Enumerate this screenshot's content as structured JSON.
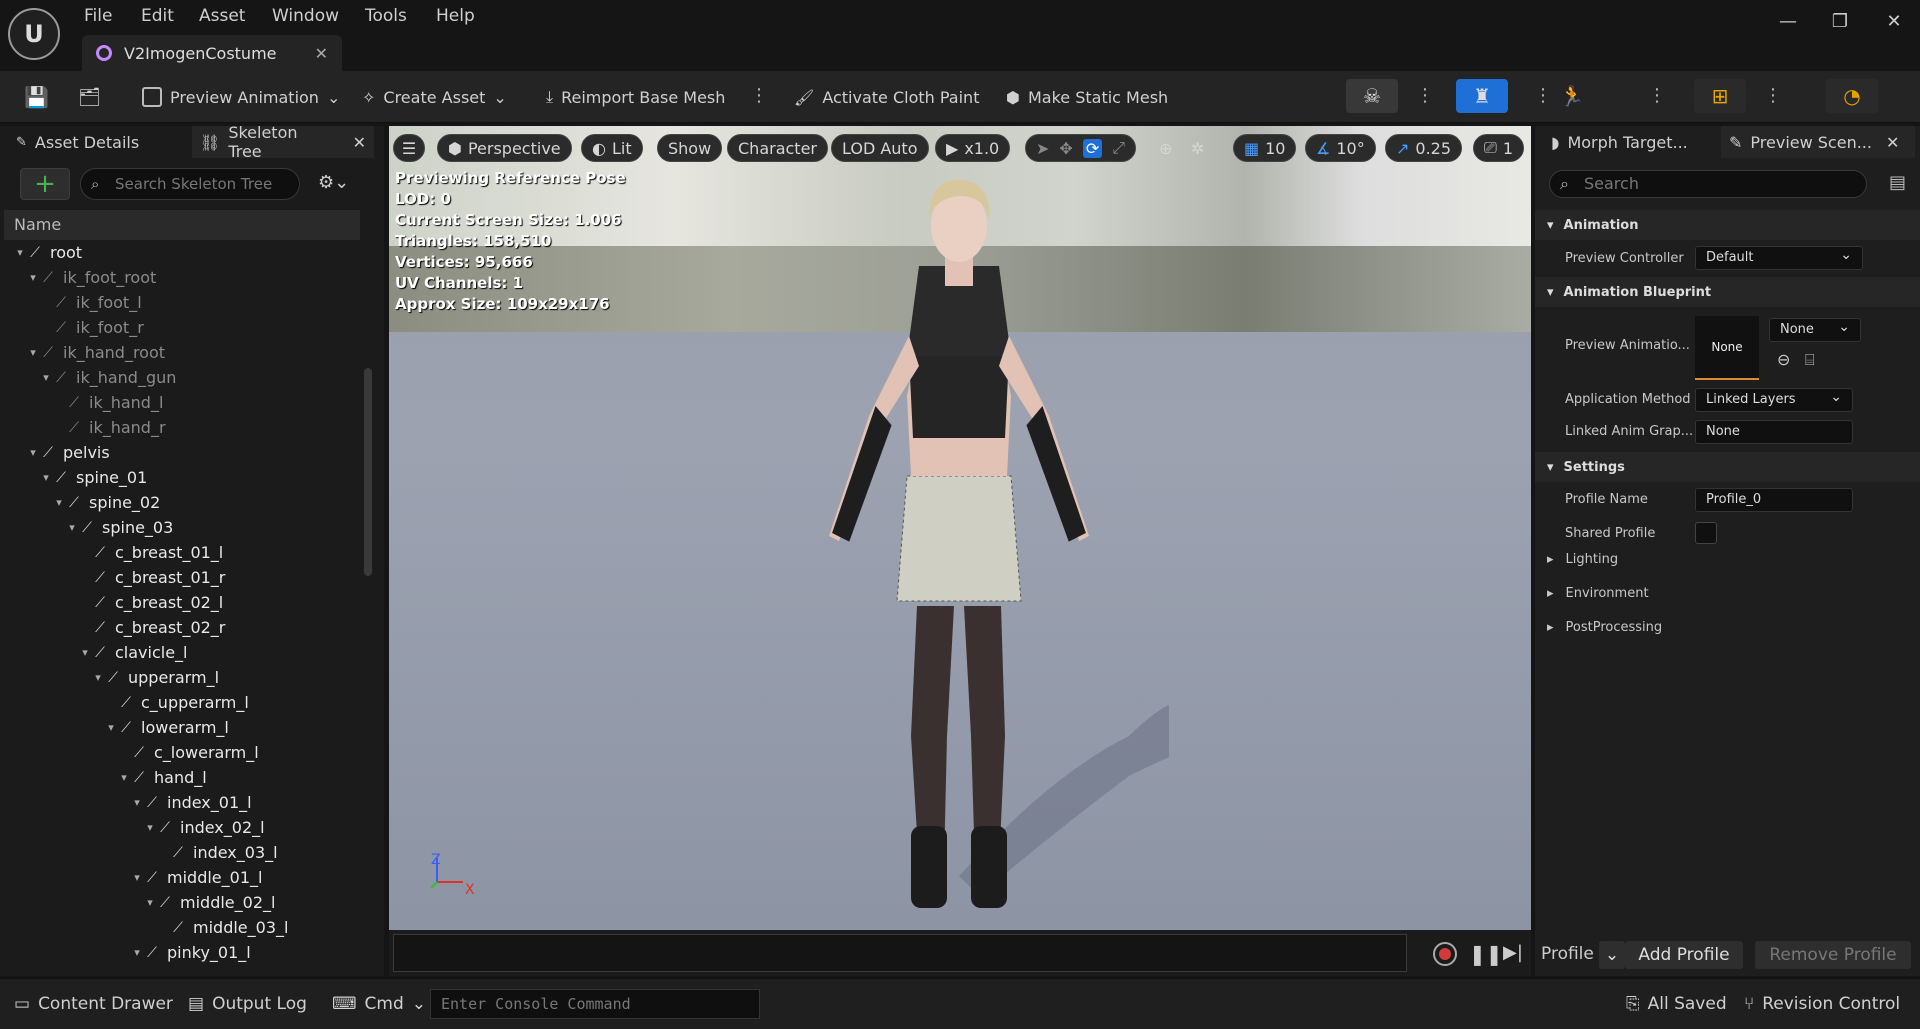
{
  "menu": [
    "File",
    "Edit",
    "Asset",
    "Window",
    "Tools",
    "Help"
  ],
  "doc_tab": "V2ImogenCostume",
  "toolbar": {
    "preview_animation": "Preview Animation",
    "create_asset": "Create Asset",
    "reimport": "Reimport Base Mesh",
    "cloth_paint": "Activate Cloth Paint",
    "static_mesh": "Make Static Mesh"
  },
  "left": {
    "tab1": "Asset Details",
    "tab2": "Skeleton Tree",
    "search_placeholder": "Search Skeleton Tree",
    "name_header": "Name",
    "bones": [
      {
        "name": "root",
        "depth": 0,
        "dim": false,
        "exp": true
      },
      {
        "name": "ik_foot_root",
        "depth": 1,
        "dim": true,
        "exp": true
      },
      {
        "name": "ik_foot_l",
        "depth": 2,
        "dim": true,
        "exp": false
      },
      {
        "name": "ik_foot_r",
        "depth": 2,
        "dim": true,
        "exp": false
      },
      {
        "name": "ik_hand_root",
        "depth": 1,
        "dim": true,
        "exp": true
      },
      {
        "name": "ik_hand_gun",
        "depth": 2,
        "dim": true,
        "exp": true
      },
      {
        "name": "ik_hand_l",
        "depth": 3,
        "dim": true,
        "exp": false
      },
      {
        "name": "ik_hand_r",
        "depth": 3,
        "dim": true,
        "exp": false
      },
      {
        "name": "pelvis",
        "depth": 1,
        "dim": false,
        "exp": true
      },
      {
        "name": "spine_01",
        "depth": 2,
        "dim": false,
        "exp": true
      },
      {
        "name": "spine_02",
        "depth": 3,
        "dim": false,
        "exp": true
      },
      {
        "name": "spine_03",
        "depth": 4,
        "dim": false,
        "exp": true
      },
      {
        "name": "c_breast_01_l",
        "depth": 5,
        "dim": false,
        "exp": false
      },
      {
        "name": "c_breast_01_r",
        "depth": 5,
        "dim": false,
        "exp": false
      },
      {
        "name": "c_breast_02_l",
        "depth": 5,
        "dim": false,
        "exp": false
      },
      {
        "name": "c_breast_02_r",
        "depth": 5,
        "dim": false,
        "exp": false
      },
      {
        "name": "clavicle_l",
        "depth": 5,
        "dim": false,
        "exp": true
      },
      {
        "name": "upperarm_l",
        "depth": 6,
        "dim": false,
        "exp": true
      },
      {
        "name": "c_upperarm_l",
        "depth": 7,
        "dim": false,
        "exp": false
      },
      {
        "name": "lowerarm_l",
        "depth": 7,
        "dim": false,
        "exp": true
      },
      {
        "name": "c_lowerarm_l",
        "depth": 8,
        "dim": false,
        "exp": false
      },
      {
        "name": "hand_l",
        "depth": 8,
        "dim": false,
        "exp": true
      },
      {
        "name": "index_01_l",
        "depth": 9,
        "dim": false,
        "exp": true
      },
      {
        "name": "index_02_l",
        "depth": 10,
        "dim": false,
        "exp": true
      },
      {
        "name": "index_03_l",
        "depth": 11,
        "dim": false,
        "exp": false
      },
      {
        "name": "middle_01_l",
        "depth": 9,
        "dim": false,
        "exp": true
      },
      {
        "name": "middle_02_l",
        "depth": 10,
        "dim": false,
        "exp": true
      },
      {
        "name": "middle_03_l",
        "depth": 11,
        "dim": false,
        "exp": false
      },
      {
        "name": "pinky_01_l",
        "depth": 9,
        "dim": false,
        "exp": true
      }
    ]
  },
  "viewport": {
    "perspective": "Perspective",
    "lit": "Lit",
    "show": "Show",
    "character": "Character",
    "lod": "LOD Auto",
    "play_speed": "x1.0",
    "grid_val": "10",
    "angle_val": "10°",
    "scale_val": "0.25",
    "cam_val": "1",
    "stats": [
      "Previewing Reference Pose",
      "LOD: 0",
      "Current Screen Size: 1.006",
      "Triangles: 158,510",
      "Vertices: 95,666",
      "UV Channels: 1",
      "Approx Size: 109x29x176"
    ],
    "axis_z": "Z",
    "axis_x": "X"
  },
  "right": {
    "tab1": "Morph Target...",
    "tab2": "Preview Scen...",
    "search_placeholder": "Search",
    "sec_animation": "Animation",
    "preview_controller_label": "Preview Controller",
    "preview_controller_val": "Default",
    "sec_anim_bp": "Animation Blueprint",
    "preview_anim_label": "Preview Animatio...",
    "thumb_none": "None",
    "preview_anim_val": "None",
    "app_method_label": "Application Method",
    "app_method_val": "Linked Layers",
    "linked_graph_label": "Linked Anim Grap...",
    "linked_graph_val": "None",
    "sec_settings": "Settings",
    "profile_name_label": "Profile Name",
    "profile_name_val": "Profile_0",
    "shared_profile_label": "Shared Profile",
    "lighting": "Lighting",
    "environment": "Environment",
    "postprocessing": "PostProcessing",
    "profile_label": "Profile",
    "add_profile": "Add Profile",
    "remove_profile": "Remove Profile"
  },
  "bottom": {
    "content_drawer": "Content Drawer",
    "output_log": "Output Log",
    "cmd": "Cmd",
    "console_placeholder": "Enter Console Command",
    "all_saved": "All Saved",
    "revision_control": "Revision Control"
  },
  "colors": {
    "accent": "#1e6fd6",
    "add_green": "#4caf50",
    "record_red": "#d23b3b"
  }
}
